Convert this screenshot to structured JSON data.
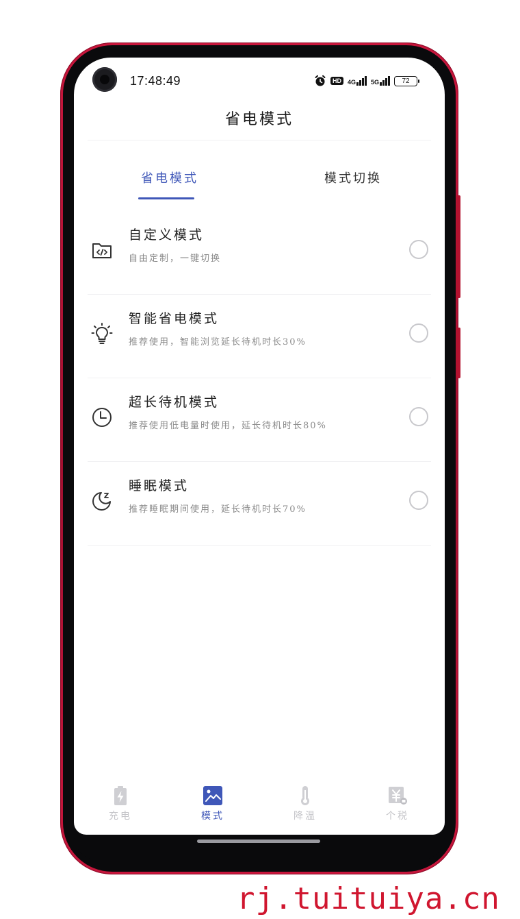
{
  "status_bar": {
    "time": "17:48:49",
    "hd_label": "HD",
    "net_4g": "4G",
    "net_5g": "5G",
    "battery": "72"
  },
  "header": {
    "title": "省电模式"
  },
  "tabs": [
    {
      "label": "省电模式",
      "active": true
    },
    {
      "label": "模式切换",
      "active": false
    }
  ],
  "modes": [
    {
      "title": "自定义模式",
      "desc": "自由定制，一键切换",
      "icon": "code-folder-icon",
      "selected": false
    },
    {
      "title": "智能省电模式",
      "desc": "推荐使用，智能浏览延长待机时长30%",
      "icon": "lightbulb-icon",
      "selected": false
    },
    {
      "title": "超长待机模式",
      "desc": "推荐使用低电量时使用，延长待机时长80%",
      "icon": "clock-icon",
      "selected": false
    },
    {
      "title": "睡眠模式",
      "desc": "推荐睡眠期间使用，延长待机时长70%",
      "icon": "moon-sleep-icon",
      "selected": false
    }
  ],
  "bottom_nav": [
    {
      "label": "充电",
      "icon": "battery-charge-icon",
      "active": false
    },
    {
      "label": "模式",
      "icon": "mode-image-icon",
      "active": true
    },
    {
      "label": "降温",
      "icon": "thermometer-icon",
      "active": false
    },
    {
      "label": "个税",
      "icon": "tax-yuan-icon",
      "active": false
    }
  ],
  "colors": {
    "accent": "#3f57b8",
    "frame": "#c8163c",
    "inactive": "#c4c4c8"
  },
  "watermark": "rj.tuituiya.cn"
}
